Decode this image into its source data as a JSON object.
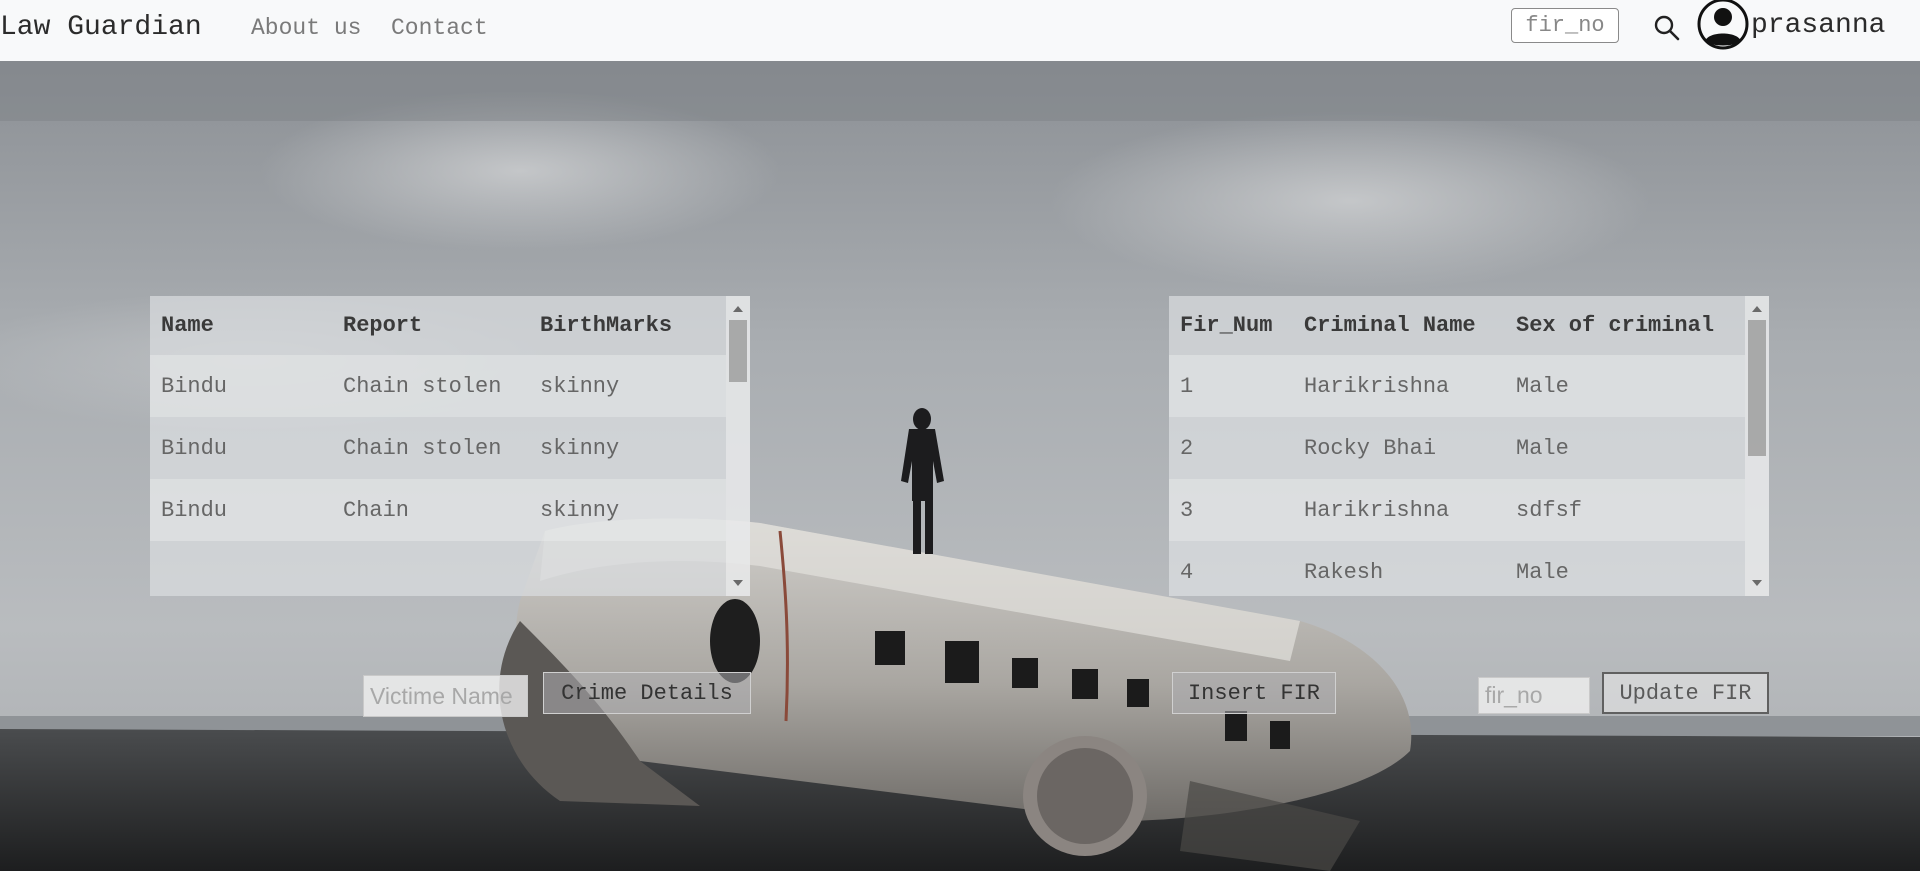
{
  "navbar": {
    "brand": "Law Guardian",
    "links": [
      "About us",
      "Contact"
    ],
    "search_placeholder": "fir_no",
    "search_icon": "search-icon",
    "avatar_icon": "user-circle-icon",
    "username": "prasanna"
  },
  "left_table": {
    "headers": [
      "Name",
      "Report",
      "BirthMarks"
    ],
    "rows": [
      [
        "Bindu",
        "Chain stolen",
        "skinny"
      ],
      [
        "Bindu",
        "Chain stolen",
        "skinny"
      ],
      [
        "Bindu",
        "Chain",
        "skinny"
      ]
    ]
  },
  "right_table": {
    "headers": [
      "Fir_Num",
      "Criminal Name",
      "Sex of criminal"
    ],
    "rows": [
      [
        "1",
        "Harikrishna",
        "Male"
      ],
      [
        "2",
        "Rocky Bhai",
        "Male"
      ],
      [
        "3",
        "Harikrishna",
        "sdfsf"
      ],
      [
        "4",
        "Rakesh",
        "Male"
      ]
    ]
  },
  "form": {
    "victim_placeholder": "Victime Name",
    "crime_details_label": "Crime Details",
    "insert_label": "Insert FIR",
    "fir_no_placeholder": "fir_no",
    "update_label": "Update FIR"
  }
}
